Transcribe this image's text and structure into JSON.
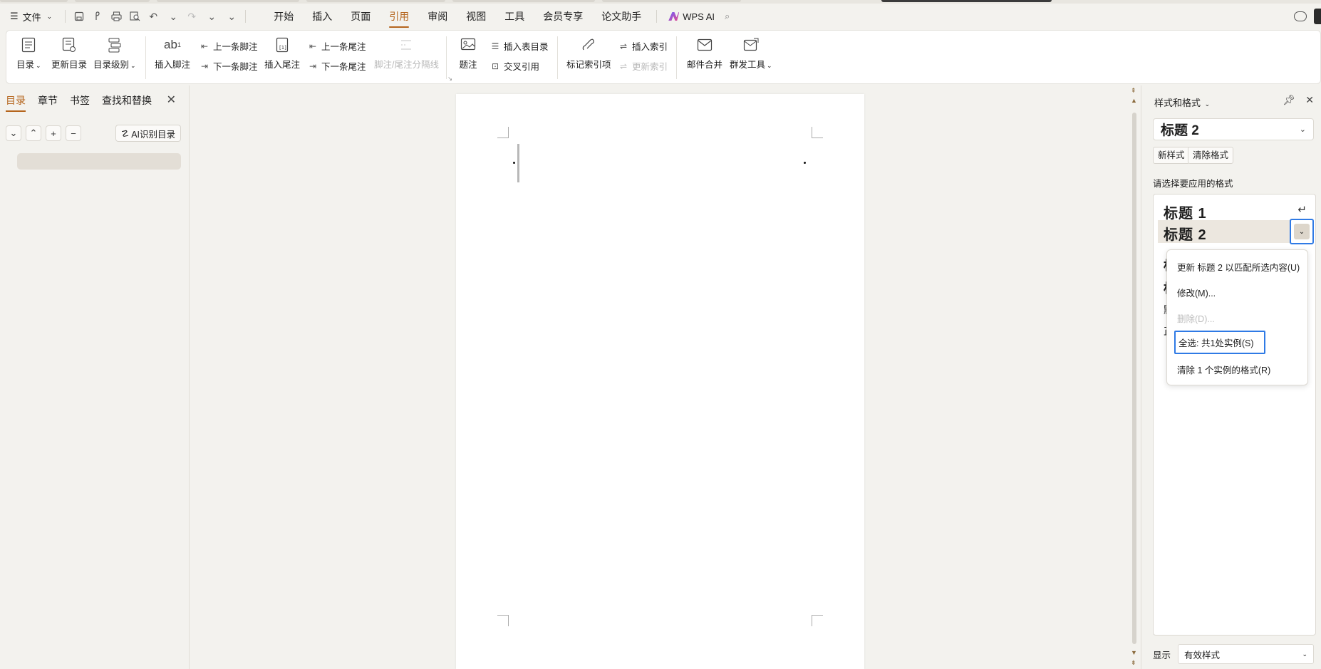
{
  "menubar": {
    "file_label": "文件",
    "menus": [
      "开始",
      "插入",
      "页面",
      "引用",
      "审阅",
      "视图",
      "工具",
      "会员专享",
      "论文助手"
    ],
    "active_menu": "引用",
    "wps_ai_label": "WPS AI"
  },
  "ribbon": {
    "toc_label": "目录",
    "update_toc_label": "更新目录",
    "toc_level_label": "目录级别",
    "insert_footnote_label": "插入脚注",
    "prev_footnote_label": "上一条脚注",
    "next_footnote_label": "下一条脚注",
    "insert_endnote_label": "插入尾注",
    "prev_endnote_label": "上一条尾注",
    "next_endnote_label": "下一条尾注",
    "separator_label": "脚注/尾注分隔线",
    "caption_label": "题注",
    "insert_table_toc_label": "插入表目录",
    "cross_ref_label": "交叉引用",
    "mark_index_label": "标记索引项",
    "insert_index_label": "插入索引",
    "update_index_label": "更新索引",
    "mail_merge_label": "邮件合并",
    "mass_send_label": "群发工具"
  },
  "leftpanel": {
    "tabs": [
      "目录",
      "章节",
      "书签",
      "查找和替换"
    ],
    "ai_toc_label": "AI识别目录"
  },
  "rightpanel": {
    "title": "样式和格式",
    "current_style": "标题 2",
    "new_style_label": "新样式",
    "clear_format_label": "清除格式",
    "hint": "请选择要应用的格式",
    "styles": [
      "标题 1",
      "标题 2"
    ],
    "context_menu": {
      "update": "更新 标题 2 以匹配所选内容(U)",
      "modify": "修改(M)...",
      "delete": "删除(D)...",
      "select_all": "全选: 共1处实例(S)",
      "clear_instances": "清除 1 个实例的格式(R)"
    },
    "show_label": "显示",
    "show_value": "有效样式"
  }
}
